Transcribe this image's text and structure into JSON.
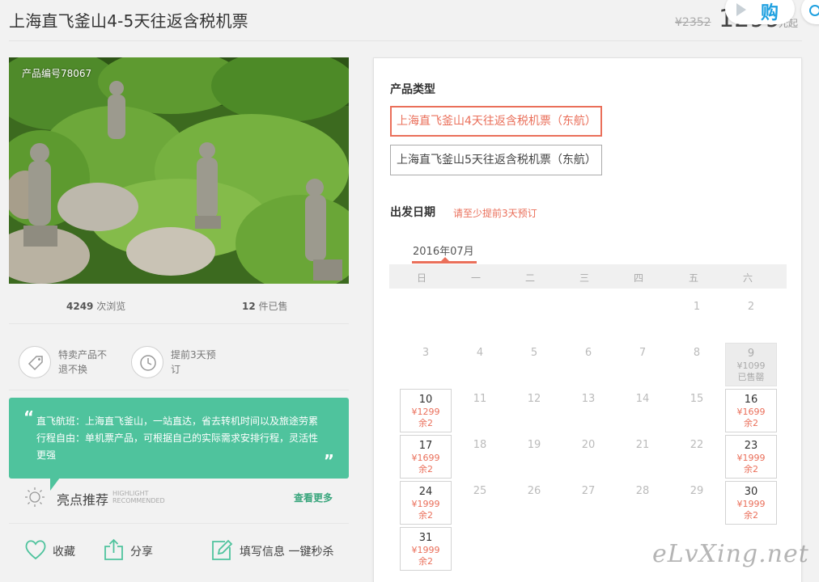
{
  "header": {
    "title": "上海直飞釜山4-5天往返含税机票",
    "old_price": "¥2352",
    "price": "1299",
    "price_unit": "元起",
    "buy_label": "购"
  },
  "product": {
    "number": "产品编号78067",
    "views_num": "4249",
    "views_label": "次浏览",
    "sold_num": "12",
    "sold_label": "件已售"
  },
  "features": [
    {
      "text": "特卖产品不退不换",
      "icon": "tag-icon"
    },
    {
      "text": "提前3天预订",
      "icon": "clock-icon"
    }
  ],
  "highlight": {
    "quote_open": "“",
    "quote_close": "”",
    "line1": "直飞航班：上海直飞釜山，一站直达，省去转机时间以及旅途劳累",
    "line2": "行程自由：单机票产品，可根据自己的实际需求安排行程，灵活性",
    "line3": "更强",
    "title": "亮点推荐",
    "en1": "HIGHLIGHT",
    "en2": "RECOMMENDED",
    "more": "查看更多"
  },
  "actions": [
    {
      "label": "收藏",
      "icon": "heart-icon"
    },
    {
      "label": "分享",
      "icon": "share-icon"
    },
    {
      "label": "填写信息 一键秒杀",
      "icon": "edit-icon"
    }
  ],
  "booking": {
    "type_title": "产品类型",
    "options": [
      "上海直飞釜山4天往返含税机票（东航）",
      "上海直飞釜山5天往返含税机票（东航）"
    ],
    "selected_option": 0,
    "date_title": "出发日期",
    "date_note": "请至少提前3天预订",
    "month": "2016年07月",
    "weekdays": [
      "日",
      "一",
      "二",
      "三",
      "四",
      "五",
      "六"
    ]
  },
  "calendar": [
    {
      "day": "1",
      "col": 5,
      "row": 0,
      "state": "past"
    },
    {
      "day": "2",
      "col": 6,
      "row": 0,
      "state": "past"
    },
    {
      "day": "3",
      "col": 0,
      "row": 1,
      "state": "past"
    },
    {
      "day": "4",
      "col": 1,
      "row": 1,
      "state": "past"
    },
    {
      "day": "5",
      "col": 2,
      "row": 1,
      "state": "past"
    },
    {
      "day": "6",
      "col": 3,
      "row": 1,
      "state": "past"
    },
    {
      "day": "7",
      "col": 4,
      "row": 1,
      "state": "past"
    },
    {
      "day": "8",
      "col": 5,
      "row": 1,
      "state": "past"
    },
    {
      "day": "9",
      "col": 6,
      "row": 1,
      "state": "sold",
      "price": "¥1099",
      "remain": "已售罄"
    },
    {
      "day": "10",
      "col": 0,
      "row": 2,
      "state": "avail",
      "price": "¥1299",
      "remain": "余2"
    },
    {
      "day": "11",
      "col": 1,
      "row": 2,
      "state": "past"
    },
    {
      "day": "12",
      "col": 2,
      "row": 2,
      "state": "past"
    },
    {
      "day": "13",
      "col": 3,
      "row": 2,
      "state": "past"
    },
    {
      "day": "14",
      "col": 4,
      "row": 2,
      "state": "past"
    },
    {
      "day": "15",
      "col": 5,
      "row": 2,
      "state": "past"
    },
    {
      "day": "16",
      "col": 6,
      "row": 2,
      "state": "avail",
      "price": "¥1699",
      "remain": "余2"
    },
    {
      "day": "17",
      "col": 0,
      "row": 3,
      "state": "avail",
      "price": "¥1699",
      "remain": "余2"
    },
    {
      "day": "18",
      "col": 1,
      "row": 3,
      "state": "past"
    },
    {
      "day": "19",
      "col": 2,
      "row": 3,
      "state": "past"
    },
    {
      "day": "20",
      "col": 3,
      "row": 3,
      "state": "past"
    },
    {
      "day": "21",
      "col": 4,
      "row": 3,
      "state": "past"
    },
    {
      "day": "22",
      "col": 5,
      "row": 3,
      "state": "past"
    },
    {
      "day": "23",
      "col": 6,
      "row": 3,
      "state": "avail",
      "price": "¥1999",
      "remain": "余2"
    },
    {
      "day": "24",
      "col": 0,
      "row": 4,
      "state": "avail",
      "price": "¥1999",
      "remain": "余2"
    },
    {
      "day": "25",
      "col": 1,
      "row": 4,
      "state": "past"
    },
    {
      "day": "26",
      "col": 2,
      "row": 4,
      "state": "past"
    },
    {
      "day": "27",
      "col": 3,
      "row": 4,
      "state": "past"
    },
    {
      "day": "28",
      "col": 4,
      "row": 4,
      "state": "past"
    },
    {
      "day": "29",
      "col": 5,
      "row": 4,
      "state": "past"
    },
    {
      "day": "30",
      "col": 6,
      "row": 4,
      "state": "avail",
      "price": "¥1999",
      "remain": "余2"
    },
    {
      "day": "31",
      "col": 0,
      "row": 5,
      "state": "avail",
      "price": "¥1999",
      "remain": "余2"
    }
  ],
  "watermark": "eLvXing.net",
  "colors": {
    "accent": "#ea6f5a",
    "highlight_green": "#4fc39d",
    "buy_blue": "#1ea0e0"
  }
}
